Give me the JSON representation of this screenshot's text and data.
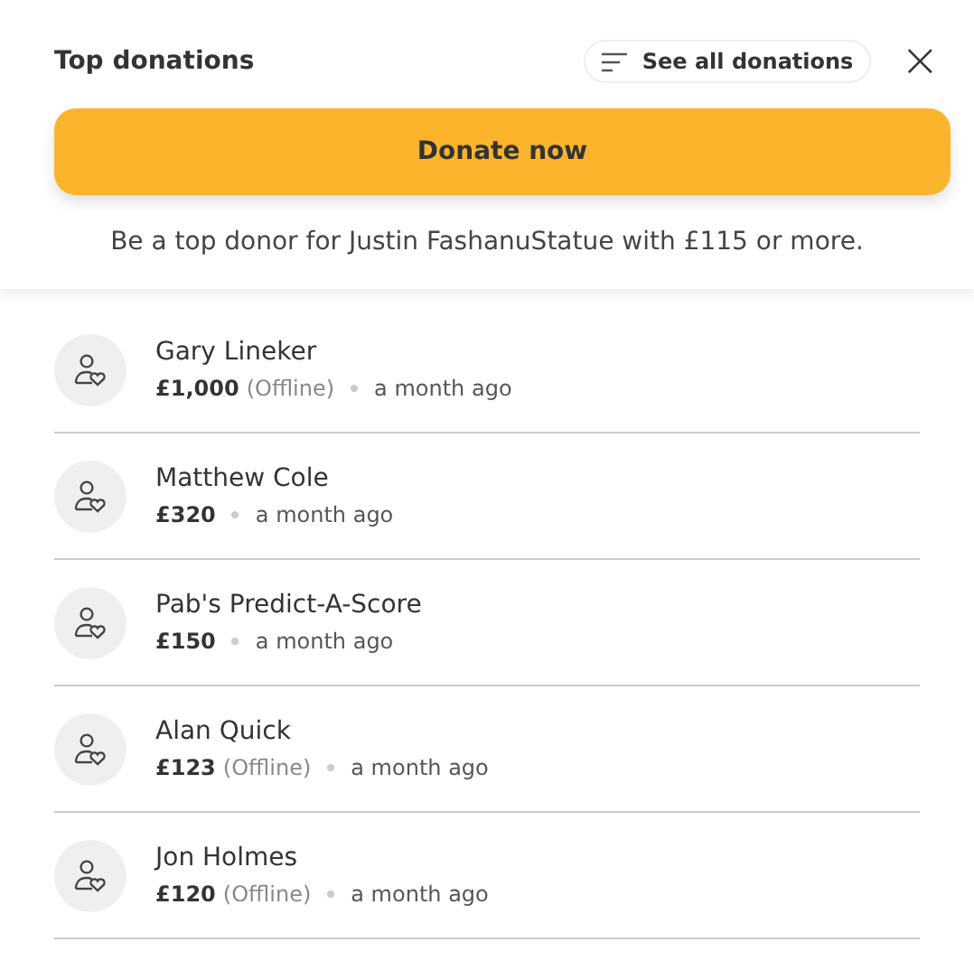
{
  "header": {
    "title": "Top donations",
    "see_all": "See all donations",
    "close": "×"
  },
  "donate_button": "Donate now",
  "notice": "Be a top donor for Justin FashanuStatue with £115 or more.",
  "donations": [
    {
      "name": "Gary Lineker",
      "amount": "£1,000",
      "note": "(Offline)",
      "time": "a month ago"
    },
    {
      "name": "Matthew Cole",
      "amount": "£320",
      "time": "a month ago"
    },
    {
      "name": "Pab's Predict-A-Score",
      "amount": "£150",
      "time": "a month ago"
    },
    {
      "name": "Alan Quick",
      "amount": "£123",
      "note": "(Offline)",
      "time": "a month ago"
    },
    {
      "name": "Jon Holmes",
      "amount": "£120",
      "note": "(Offline)",
      "time": "a month ago"
    }
  ]
}
